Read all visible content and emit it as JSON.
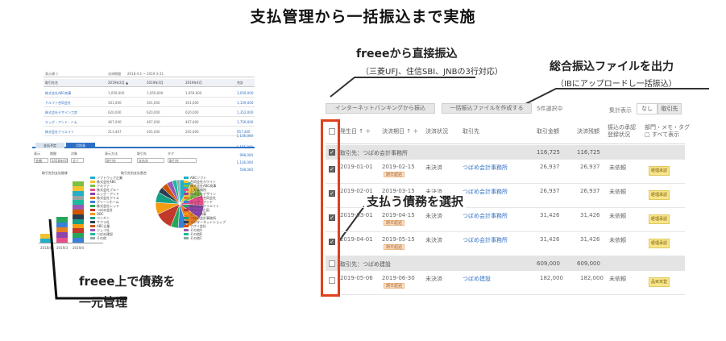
{
  "main_title": "支払管理から一括振込まで実施",
  "left_caption": {
    "line1": "freee上で債務を",
    "line2": "一元管理"
  },
  "annotations": {
    "direct_transfer": {
      "title": "freeeから直接振込",
      "subtitle": "（三菱UFJ、住信SBI、JNBの3行対応）"
    },
    "bulk_file": {
      "title": "総合振込ファイルを出力",
      "subtitle": "（IBにアップロードし一括振込）"
    },
    "select_debts": "支払う債務を選択"
  },
  "report": {
    "header": [
      "表示順 ▽",
      "決済期間",
      "2018-4-1 ~ 2019-3-31"
    ],
    "columns": [
      "取引先名",
      "2019年2月 ▲",
      "2019年3月",
      "2019年4月",
      "合計"
    ],
    "rows": [
      [
        "株式会社ABC商事",
        "1,059,000",
        "1,059,000",
        "1,059,000",
        "3,059,000"
      ],
      [
        "アルファ合同会社",
        "301,000",
        "301,000",
        "301,000",
        "1,159,000"
      ],
      [
        "株式会社デザイン工房",
        "620,000",
        "620,000",
        "620,000",
        "1,352,000"
      ],
      [
        "エッグ・アンド・ハム",
        "467,000",
        "467,000",
        "467,000",
        "1,756,000"
      ],
      [
        "株式会社クリエイト",
        "213,467",
        "205,000",
        "205,000",
        "957,400"
      ]
    ],
    "total_value": "1,136,000",
    "tabs": [
      "支払予定",
      "月別表"
    ],
    "filter_labels": [
      "表示",
      "期間",
      "対象",
      "表示方法",
      "取引先",
      "タグ"
    ],
    "filter_values": [
      "金額",
      "2018年4月",
      "全て",
      "取引先",
      "支払先",
      "取引先"
    ],
    "right_numbers": [
      "1,155,000",
      "998,000",
      "1,136,000",
      "508,000"
    ],
    "bar_chart_title": "取引先別支払推移",
    "pie_chart_title": "取引先別支払割合",
    "bar_chart_data": {
      "categories": [
        "2018/4",
        "2019/3",
        "2019/4"
      ],
      "totals": [
        0.05,
        0.15,
        0.36
      ]
    },
    "legend_bar": [
      "ソフトウェア企業",
      "株式会社ABC",
      "アルファ",
      "株式会社ブルー",
      "エッグ・アンド",
      "株式会社クリエ",
      "グリーンホーム",
      "株式会社レッド",
      "つばめ会計",
      "DBC",
      "ペンギン",
      "サクラ社",
      "ABC企業",
      "ジェイ社",
      "つばめ建設",
      "その他"
    ],
    "legend_pie": [
      "ABCソフト",
      "合同会社ホワイト",
      "株式会社ABC商事",
      "上野事務所",
      "株式会社デザイン",
      "アルファ合同会社",
      "エッグ・アンド",
      "株式会社クリエイト",
      "グリーン企画",
      "ブルー商事",
      "つばめ会計事務所",
      "インターネットショップ",
      "アグリ会社",
      "その他A",
      "その他B",
      "その他C"
    ],
    "pie_chart_data": {
      "colors": [
        "#22b0c8",
        "#f2c230",
        "#7cc043",
        "#e84d8a",
        "#8e44ad",
        "#e67e22",
        "#3b7fd8",
        "#26a65b",
        "#c0392b",
        "#f39c12",
        "#16a085",
        "#2c3e50",
        "#d35400",
        "#9b59b6",
        "#1abc9c",
        "#95a5a6"
      ],
      "shares": [
        0.08,
        0.06,
        0.05,
        0.07,
        0.09,
        0.1,
        0.06,
        0.05,
        0.12,
        0.08,
        0.07,
        0.04,
        0.04,
        0.04,
        0.03,
        0.02
      ]
    }
  },
  "panel": {
    "toolbar": {
      "btn_internet": "インターネットバンキングから振込",
      "btn_bulk": "一括振込ファイルを作成する",
      "selected": "5件選択中",
      "grouping_label": "集計表示",
      "seg_none": "なし",
      "seg_partner": "取引先"
    },
    "headers": [
      "発生日 ↑ ＋",
      "決済期日 ↑ ＋",
      "決済状況",
      "取引先",
      "取引金額",
      "決済残額",
      "振込の承認\n登録状況",
      "部門・メモ・タグ\n□ すべて表示"
    ],
    "groups": [
      {
        "label": "取引先：つばめ会計事務所",
        "amount": "116,725",
        "balance": "116,725"
      },
      {
        "label": "取引先：つばめ建設",
        "amount": "609,000",
        "balance": "609,000"
      }
    ],
    "rows": [
      {
        "checked": true,
        "date": "2019-01-01",
        "due": "2019-02-15",
        "tag": "期日超過",
        "status": "未決済",
        "partner": "つばめ会計事務所",
        "amount": "26,937",
        "balance": "26,937",
        "approval": "未依頼",
        "badge": "経理承認"
      },
      {
        "checked": true,
        "date": "2019-02-01",
        "due": "2019-03-15",
        "tag": "期日超過",
        "status": "未決済",
        "partner": "つばめ会計事務所",
        "amount": "26,937",
        "balance": "26,937",
        "approval": "未依頼",
        "badge": "経理承認"
      },
      {
        "checked": true,
        "date": "2019-03-01",
        "due": "2019-04-15",
        "tag": "期日超過",
        "status": "未決済",
        "partner": "つばめ会計事務所",
        "amount": "31,426",
        "balance": "31,426",
        "approval": "未依頼",
        "badge": "経理承認"
      },
      {
        "checked": true,
        "date": "2019-04-01",
        "due": "2019-05-15",
        "tag": "期日超過",
        "status": "未決済",
        "partner": "つばめ会計事務所",
        "amount": "31,426",
        "balance": "31,426",
        "approval": "未依頼",
        "badge": "経理承認"
      },
      {
        "checked": false,
        "date": "2019-05-06",
        "due": "2019-06-30",
        "tag": "期日超過",
        "status": "未決済",
        "partner": "つばめ建設",
        "amount": "182,000",
        "balance": "182,000",
        "approval": "未依頼",
        "badge": "品目未登"
      }
    ]
  }
}
